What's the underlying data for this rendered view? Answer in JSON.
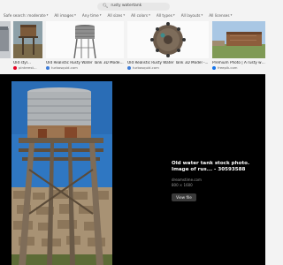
{
  "search": {
    "query": "rusty watertank"
  },
  "filters": [
    {
      "label": "Safe search: moderate"
    },
    {
      "label": "All images"
    },
    {
      "label": "Any time"
    },
    {
      "label": "All sizes"
    },
    {
      "label": "All colors"
    },
    {
      "label": "All types"
    },
    {
      "label": "All layouts"
    },
    {
      "label": "All licenses"
    }
  ],
  "thumbnails": [
    {
      "title": "",
      "source": "",
      "source_color": "#888888"
    },
    {
      "title": "Old styl...",
      "source": "pinterest...",
      "source_color": "#e60023"
    },
    {
      "title": "Old Realistic Rusty Water Tank 3D Model -...",
      "source": "turbosquid.com",
      "source_color": "#3b7bd9"
    },
    {
      "title": "Old Realistic Rusty Water Tank 3D Model -...",
      "source": "turbosquid.com",
      "source_color": "#3b7bd9"
    },
    {
      "title": "Premium Photo | A rusty water ta...",
      "source": "freepik.com",
      "source_color": "#1273eb"
    }
  ],
  "detail": {
    "title": "Old water tank stock photo. Image of rus... - 30593588",
    "site": "dreamstime.com",
    "size": "800 × 1600",
    "view_button": "View file"
  },
  "colors": {
    "accent": "#3a3a3a",
    "viewer_bg": "#000000",
    "page_bg": "#f3f3f3"
  }
}
